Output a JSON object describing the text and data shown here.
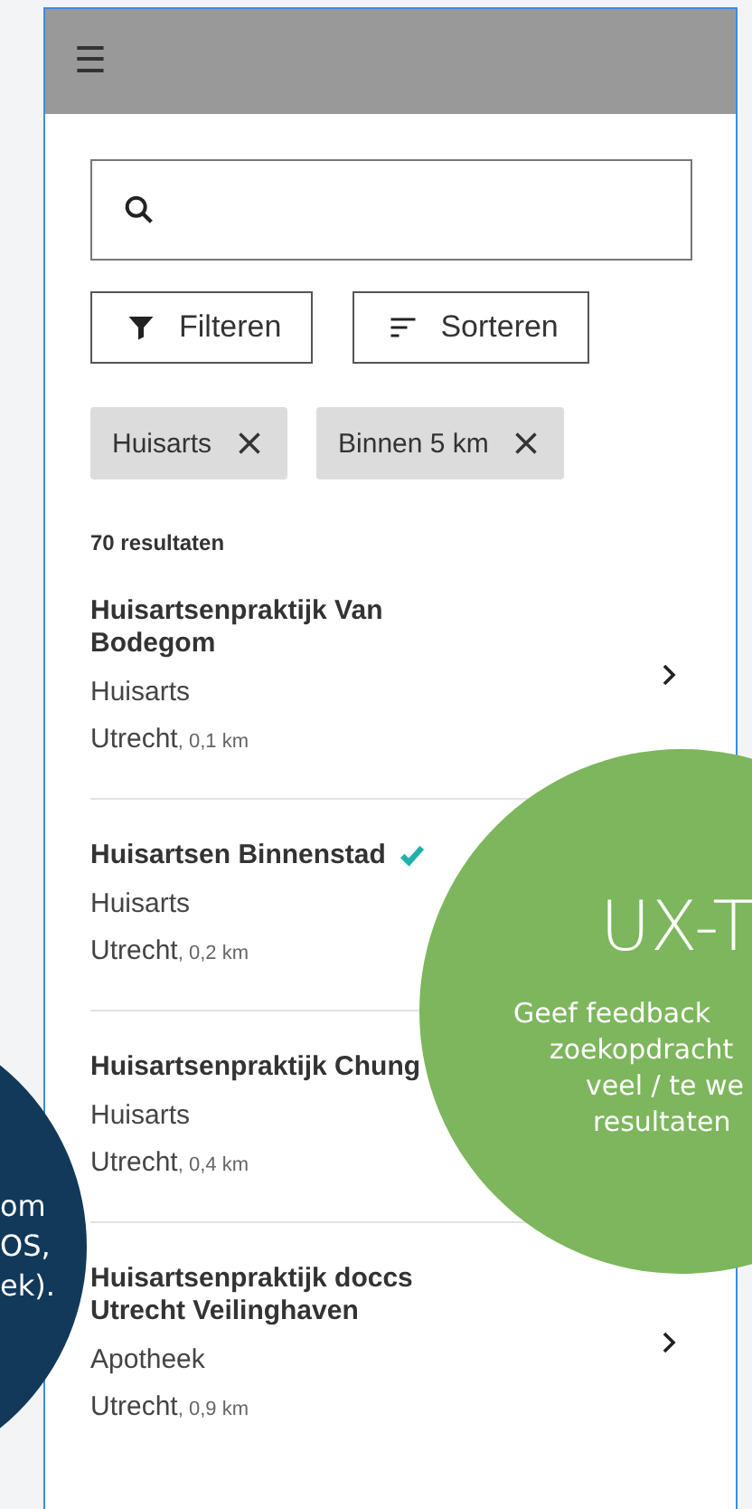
{
  "header": {
    "menu": "☰"
  },
  "actions": [
    {
      "kind": "filter",
      "label": "Filteren"
    },
    {
      "kind": "sort",
      "label": "Sorteren"
    }
  ],
  "chips": [
    {
      "label": "Huisarts"
    },
    {
      "label": "Binnen 5 km"
    }
  ],
  "result_count": "70 resultaten",
  "results": [
    {
      "name": "Huisartsenpraktijk Van Bodegom",
      "type": "Huisarts",
      "city": "Utrecht",
      "distance": ", 0,1 km",
      "verified": false
    },
    {
      "name": "Huisartsen Binnenstad",
      "type": "Huisarts",
      "city": "Utrecht",
      "distance": ", 0,2 km",
      "verified": true
    },
    {
      "name": "Huisartsenpraktijk Chung",
      "type": "Huisarts",
      "city": "Utrecht",
      "distance": ", 0,4 km"
    },
    {
      "name": "Huisartsenpraktijk doccs Utrecht Veilinghaven",
      "type": "Apotheek",
      "city": "Utrecht",
      "distance": ", 0,9 km",
      "verified": false
    }
  ],
  "note_left": {
    "lines": [
      "om",
      "OS,",
      "ek)."
    ]
  },
  "note_right": {
    "title": "UX-T",
    "lines": [
      "Geef feedback",
      "zoekopdracht",
      "veel / te we",
      "resultaten"
    ]
  }
}
